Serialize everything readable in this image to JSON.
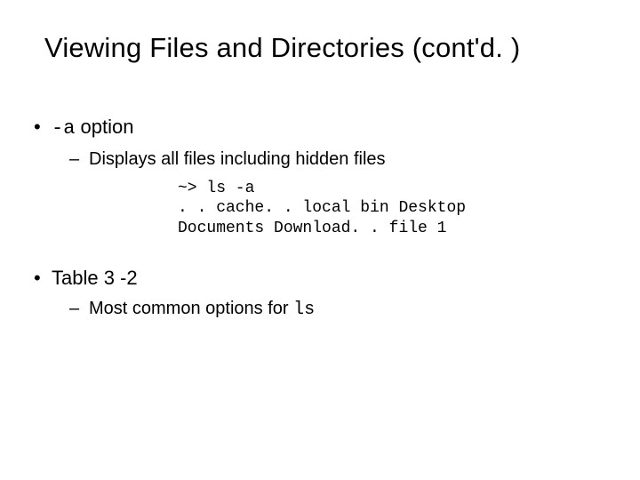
{
  "title": "Viewing Files and Directories (cont'd. )",
  "b1": {
    "opt": "-a",
    "tail": " option",
    "sub": "Displays all files including hidden files",
    "code": "~> ls -a\n. . cache. . local bin Desktop\nDocuments Download. . file 1"
  },
  "b2": {
    "label": "Table 3 -2",
    "sub_pre": "Most common options for ",
    "sub_code": "ls"
  }
}
